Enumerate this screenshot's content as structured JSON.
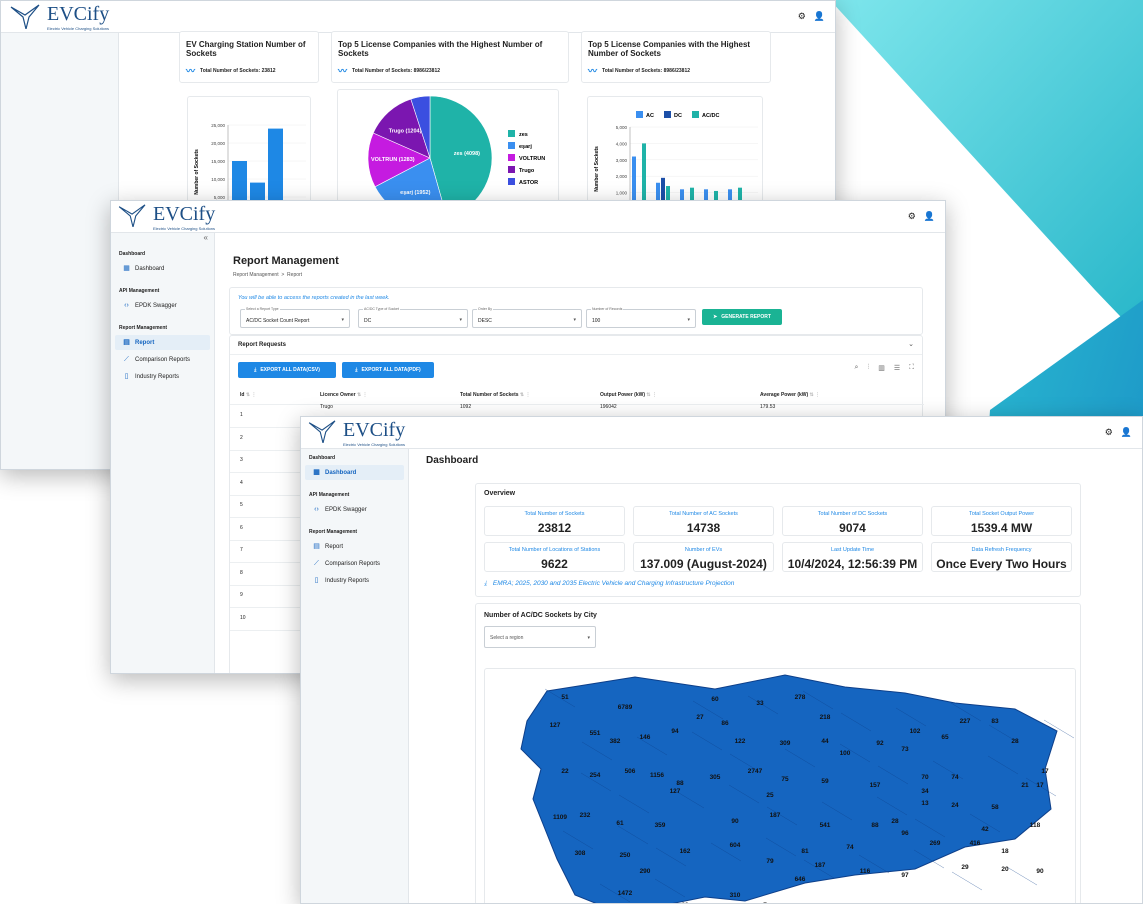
{
  "brand": {
    "name": "EVCify",
    "tagline": "Electric Vehicle Charging Solutions"
  },
  "colors": {
    "accent": "#1e88e5",
    "map_fill": "#1565c0",
    "teal": "#5cd4df",
    "pie": [
      "#1fb3a8",
      "#3a8ff0",
      "#c51be0",
      "#7b16b0",
      "#3b4fe0"
    ]
  },
  "window1": {
    "card1": {
      "title": "EV Charging Station Number of Sockets",
      "stat": "Total Number of Sockets: 23812"
    },
    "card2": {
      "title": "Top 5 License Companies with the Highest Number of Sockets",
      "stat": "Total Number of Sockets: 8986/23812"
    },
    "card3": {
      "title": "Top 5 License Companies with the Highest Number of Sockets",
      "stat": "Total Number of Sockets: 8986/23812"
    }
  },
  "chart_data": [
    {
      "type": "bar",
      "ylabel": "Number of Sockets",
      "y_ticks": [
        "25,000",
        "20,000",
        "15,000",
        "10,000",
        "5,000"
      ],
      "values": [
        15000,
        9000,
        24000
      ]
    },
    {
      "type": "pie",
      "slices": [
        {
          "label": "zes (4098)",
          "name": "zes",
          "value": 4098
        },
        {
          "label": "eşarj (1952)",
          "name": "eşarj",
          "value": 1952
        },
        {
          "label": "VOLTRUN (1283)",
          "name": "VOLTRUN",
          "value": 1283
        },
        {
          "label": "Trugo (1204)",
          "name": "Trugo",
          "value": 1204
        },
        {
          "label": "",
          "name": "ASTOR",
          "value": 449
        }
      ]
    },
    {
      "type": "bar",
      "ylabel": "Number of Sockets",
      "legend": [
        "AC",
        "DC",
        "AC/DC"
      ],
      "y_ticks": [
        "5,000",
        "4,000",
        "3,000",
        "2,000",
        "1,000"
      ],
      "series": [
        {
          "name": "AC",
          "values": [
            3200,
            1600,
            1200,
            1200,
            1200
          ]
        },
        {
          "name": "DC",
          "values": [
            300,
            1900,
            200,
            150,
            200
          ]
        },
        {
          "name": "AC/DC",
          "values": [
            4000,
            1400,
            1300,
            1100,
            1300
          ]
        }
      ]
    }
  ],
  "window2": {
    "collapse": "«",
    "sidebar": [
      {
        "section": "Dashboard",
        "items": [
          {
            "label": "Dashboard",
            "icon": "grid-icon"
          }
        ]
      },
      {
        "section": "API Management",
        "items": [
          {
            "label": "EPDK Swagger",
            "icon": "code-icon"
          }
        ]
      },
      {
        "section": "Report Management",
        "items": [
          {
            "label": "Report",
            "icon": "report-icon",
            "active": true
          },
          {
            "label": "Comparison Reports",
            "icon": "compare-icon"
          },
          {
            "label": "Industry Reports",
            "icon": "document-icon"
          }
        ]
      }
    ],
    "title": "Report Management",
    "breadcrumb": "Report Management  >  Report",
    "notice": "You will be able to access the reports created in the last week.",
    "filters": [
      {
        "label": "Select a Report Type",
        "value": "AC/DC Socket Count Report"
      },
      {
        "label": "AC/DC Type of Socket",
        "value": "DC"
      },
      {
        "label": "Order By",
        "value": "DESC"
      },
      {
        "label": "Number of Records",
        "value": "100"
      }
    ],
    "generate": "GENERATE REPORT",
    "requests": "Report Requests",
    "export_csv": "EXPORT ALL DATA(CSV)",
    "export_pdf": "EXPORT ALL DATA(PDF)",
    "columns": [
      "Id",
      "Licence Owner",
      "Total Number of Sockets",
      "Output Power (kW)",
      "Average Power (kW)"
    ],
    "first_row": {
      "id": "1",
      "owner": "Trugo",
      "sockets": "1092",
      "output": "196042",
      "average": "179.53"
    },
    "row_ids": [
      "1",
      "2",
      "3",
      "4",
      "5",
      "6",
      "7",
      "8",
      "9",
      "10"
    ]
  },
  "window3": {
    "sidebar": [
      {
        "section": "Dashboard",
        "items": [
          {
            "label": "Dashboard",
            "icon": "grid-icon",
            "active": true
          }
        ]
      },
      {
        "section": "API Management",
        "items": [
          {
            "label": "EPDK Swagger",
            "icon": "code-icon"
          }
        ]
      },
      {
        "section": "Report Management",
        "items": [
          {
            "label": "Report",
            "icon": "report-icon"
          },
          {
            "label": "Comparison Reports",
            "icon": "compare-icon"
          },
          {
            "label": "Industry Reports",
            "icon": "document-icon"
          }
        ]
      }
    ],
    "title": "Dashboard",
    "overview": "Overview",
    "kpis": [
      {
        "label": "Total Number of Sockets",
        "value": "23812"
      },
      {
        "label": "Total Number of AC Sockets",
        "value": "14738"
      },
      {
        "label": "Total Number of DC Sockets",
        "value": "9074"
      },
      {
        "label": "Total Socket Output Power",
        "value": "1539.4 MW"
      },
      {
        "label": "Total Number of Locations of Stations",
        "value": "9622"
      },
      {
        "label": "Number of EVs",
        "value": "137.009 (August-2024)"
      },
      {
        "label": "Last Update Time",
        "value": "10/4/2024, 12:56:39 PM"
      },
      {
        "label": "Data Refresh Frequency",
        "value": "Once Every Two Hours"
      }
    ],
    "projection_link": "EMRA; 2025, 2030 and 2035 Electric Vehicle and Charging Infrastructure Projection",
    "map_title": "Number of AC/DC Sockets by City",
    "region_placeholder": "Select a region",
    "map_labels": [
      "51",
      "127",
      "6789",
      "551",
      "382",
      "146",
      "94",
      "27",
      "60",
      "86",
      "33",
      "278",
      "218",
      "122",
      "309",
      "44",
      "100",
      "92",
      "73",
      "102",
      "65",
      "227",
      "83",
      "28",
      "17",
      "21",
      "70",
      "22",
      "254",
      "506",
      "1156",
      "88",
      "305",
      "2747",
      "75",
      "59",
      "157",
      "74",
      "17",
      "28",
      "127",
      "25",
      "34",
      "13",
      "24",
      "58",
      "118",
      "42",
      "1109",
      "232",
      "61",
      "359",
      "187",
      "90",
      "541",
      "88",
      "96",
      "269",
      "416",
      "18",
      "308",
      "250",
      "162",
      "604",
      "79",
      "81",
      "74",
      "187",
      "116",
      "97",
      "29",
      "20",
      "90",
      "290",
      "646",
      "1472",
      "69",
      "310",
      "7"
    ]
  }
}
